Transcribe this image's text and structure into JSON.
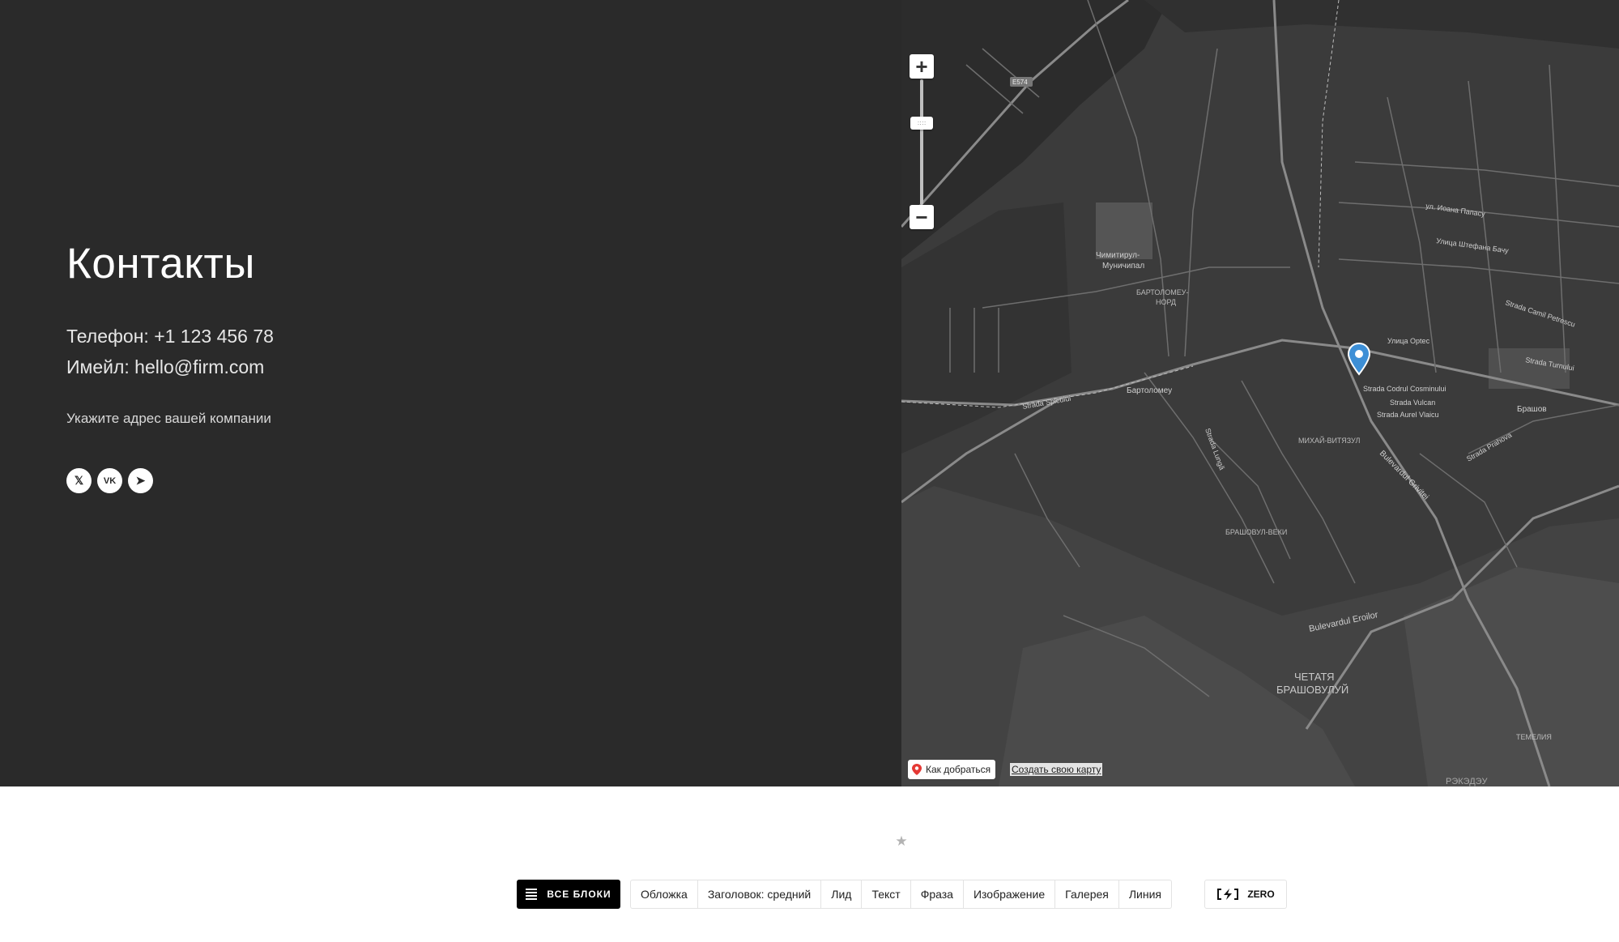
{
  "contacts": {
    "title": "Контакты",
    "phone": "Телефон: +1 123 456 78",
    "email": "Имейл: hello@firm.com",
    "address": "Укажите адрес вашей компании",
    "socials": [
      {
        "name": "x",
        "glyph": "𝕏"
      },
      {
        "name": "vk",
        "glyph": "VK"
      },
      {
        "name": "telegram",
        "glyph": "➤"
      }
    ]
  },
  "map": {
    "zoom_in": "+",
    "zoom_out": "−",
    "route_label": "Как добраться",
    "create_map_link": "Создать свою карту",
    "labels": {
      "cemetery": "Чимитирул-\nМуничипал",
      "bartolomeu_nord": "БАРТОЛОМЕУ-\nНОРД",
      "bartolomeu": "Бартоломеу",
      "brasov": "Брашов",
      "mihai_viteazul": "МИХАЙ-ВИТЯЗУЛ",
      "brasovul_vechi": "БРАШОВУЛ-ВЕКИ",
      "cetatea": "ЧЕТАТЯ\nБРАШОВУЛУЙ",
      "temelia": "ТЕМЕЛИЯ",
      "racadau": "РЭКЭДЭУ",
      "bd_eroilor": "Bulevardul Eroilor",
      "bd_grivitei": "Bulevardul Grivitei",
      "str_spicului": "Strada Spicului",
      "str_lunga": "Strada Lungă",
      "str_codrul": "Strada Codrul Cosminului",
      "str_vulcan": "Strada Vulcan",
      "str_aurel": "Strada Aurel Vlaicu",
      "str_prahova": "Strada Prahova",
      "ul_ioana": "ул. Иоана Папасу",
      "ul_stefana": "Улица Штефана Бачу",
      "ul_ortec": "Улица Орtеc",
      "str_camil": "Strada Camil Petrescu",
      "str_turnului": "Strada Turnului",
      "e574": "E574"
    }
  },
  "toolbar": {
    "all_blocks": "ВСЕ БЛОКИ",
    "blocks": [
      "Обложка",
      "Заголовок: средний",
      "Лид",
      "Текст",
      "Фраза",
      "Изображение",
      "Галерея",
      "Линия"
    ],
    "zero": "ZERO"
  },
  "colors": {
    "dark_bg": "#2a2a2a",
    "map_bg": "#3a3a3a",
    "pin": "#3d8fd6"
  }
}
